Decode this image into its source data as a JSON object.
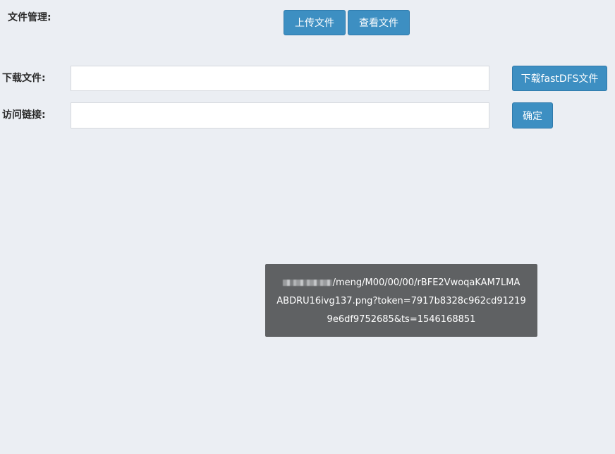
{
  "file_management": {
    "label": "文件管理:",
    "upload_button": "上传文件",
    "view_button": "查看文件"
  },
  "download": {
    "label": "下载文件:",
    "value": "",
    "placeholder": "",
    "button": "下载fastDFS文件"
  },
  "access_link": {
    "label": "访问链接:",
    "value": "",
    "placeholder": "",
    "button": "确定"
  },
  "toast": {
    "line1": "/meng/M00/00/00/rBFE2VwoqaKAM7LMA",
    "line2": "ABDRU16ivg137.png?token=7917b8328c962cd91219",
    "line3": "9e6df9752685&ts=1546168851"
  },
  "colors": {
    "background": "#ebeef3",
    "button": "#3d8fc2",
    "toast": "#5f6163"
  }
}
